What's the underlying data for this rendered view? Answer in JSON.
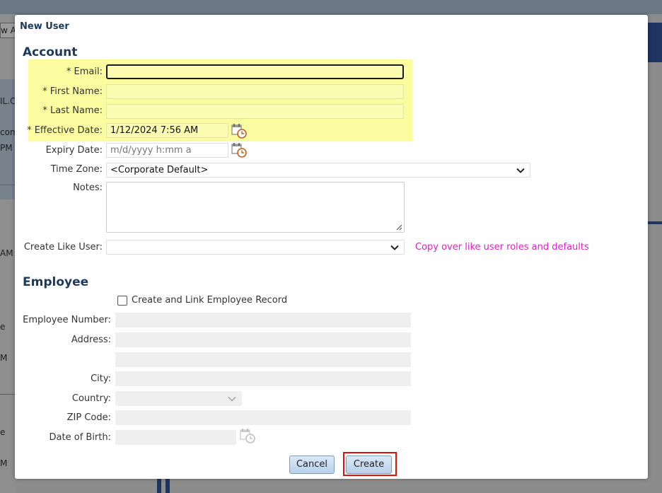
{
  "background": {
    "tab_fragment": "w A",
    "fragments": [
      "IL.C",
      "com",
      "PM",
      "AM",
      "e",
      "M",
      "e",
      "M"
    ]
  },
  "dialog": {
    "title": "New User",
    "account": {
      "heading": "Account",
      "email": {
        "label": "* Email:",
        "value": ""
      },
      "first_name": {
        "label": "* First Name:",
        "value": ""
      },
      "last_name": {
        "label": "* Last Name:",
        "value": ""
      },
      "effective_date": {
        "label": "* Effective Date:",
        "value": "1/12/2024 7:56 AM"
      },
      "expiry_date": {
        "label": "Expiry Date:",
        "value": "",
        "placeholder": "m/d/yyyy h:mm a"
      },
      "time_zone": {
        "label": "Time Zone:",
        "value": "<Corporate Default>"
      },
      "notes": {
        "label": "Notes:",
        "value": ""
      },
      "create_like_user": {
        "label": "Create Like User:",
        "value": "",
        "hint": "Copy over like user roles and defaults"
      }
    },
    "employee": {
      "heading": "Employee",
      "create_link_label": "Create and Link Employee Record",
      "create_link_checked": false,
      "employee_number": {
        "label": "Employee Number:",
        "value": ""
      },
      "address": {
        "label": "Address:",
        "line1": "",
        "line2": ""
      },
      "city": {
        "label": "City:",
        "value": ""
      },
      "country": {
        "label": "Country:",
        "value": ""
      },
      "zip_code": {
        "label": "ZIP Code:",
        "value": ""
      },
      "date_of_birth": {
        "label": "Date of Birth:",
        "value": ""
      }
    },
    "buttons": {
      "cancel": "Cancel",
      "create": "Create"
    }
  },
  "colors": {
    "required_highlight": "#fbfca0",
    "section_heading": "#1c3a5e",
    "hint_link": "#e020c8",
    "create_outline": "#e01010"
  }
}
